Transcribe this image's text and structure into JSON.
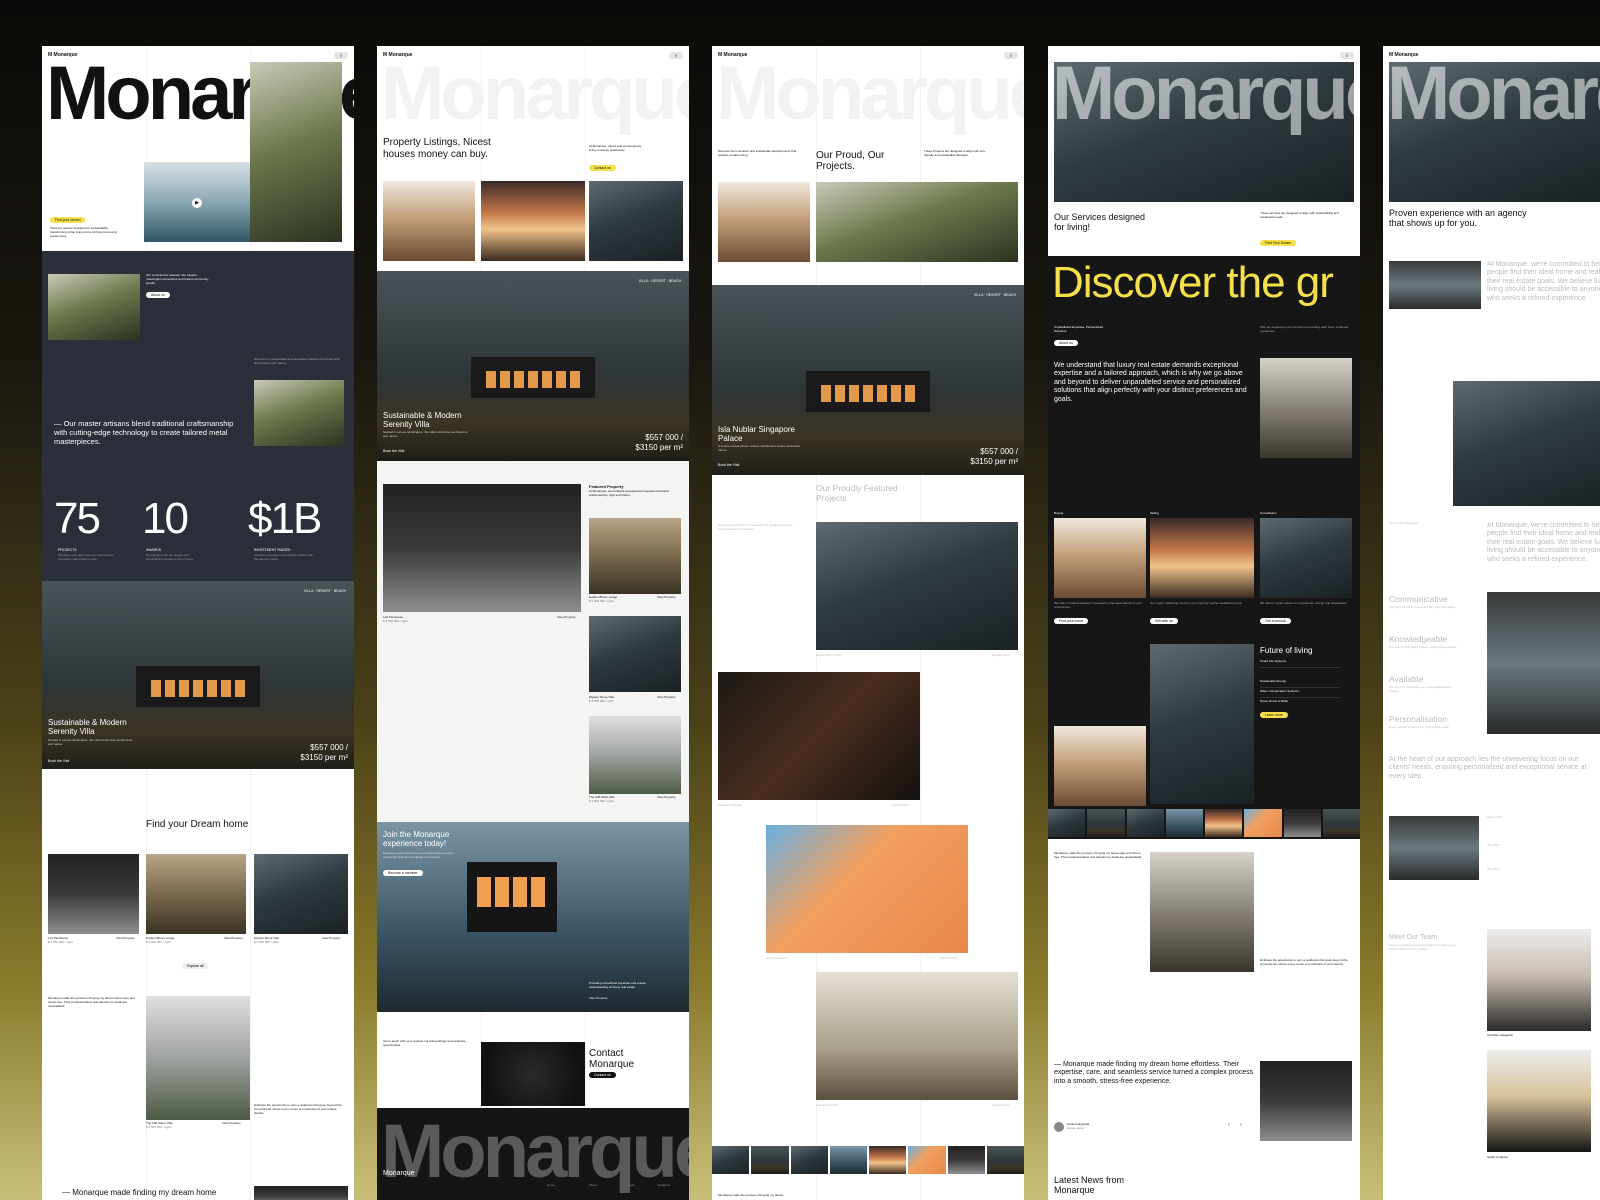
{
  "brand": "Monarque",
  "logo": "M Monarque",
  "menu": "≡",
  "p1": {
    "cta": "Find your dream",
    "intro": "Visionary spaces designed for sustainability, transforming urban living and enriching community experiences.",
    "about": "Our commitment extends: Our experts meaningful connections and fosters community growth.",
    "about_btn": "About us",
    "side_text": "We focus on sustainable and innovative solutions for homes that blend luxury with nature.",
    "quote": "— Our master artisans blend traditional craftsmanship with cutting-edge technology to create tailored metal masterpieces.",
    "stats": [
      {
        "value": "75",
        "label": "PROJECTS",
        "desc": "Monarque has delivered over seventy-five properties nationwide to date."
      },
      {
        "value": "10",
        "label": "AWARDS",
        "desc": "Recognized with ten design and sustainability awards in the industry."
      },
      {
        "value": "$1B",
        "label": "INVESTMENT RAISED",
        "desc": "Investors entrusted over a billion dollars with Monarque's vision."
      }
    ],
    "tags": "VILLA · RESORT · BEACH",
    "villa_title": "Sustainable & Modern Serenity Villa",
    "villa_desc": "Nestled in serene landscapes, this villa harmonizes architecture and nature.",
    "villa_price": "$557 000 / $3150 per m²",
    "book": "Book the Visit",
    "dream": "Find your Dream home",
    "cards": [
      {
        "name": "Loft Penthouse",
        "price": "$ 4 650 000 / night",
        "link": "View Property"
      },
      {
        "name": "Golden Bloom Lodge",
        "price": "$ 2 000 000 / night",
        "link": "View Property"
      },
      {
        "name": "Elysian Shore Villa",
        "price": "$ 3 500 000 / night",
        "link": "View Property"
      }
    ],
    "explore": "Explore all",
    "simplify": "Monarque made the process of buying my dream home easy and stress-free. Their professionalism and attention to detail are unparalleled.",
    "cliff_name": "The Cliff Stand Villa",
    "cliff_price": "$ 4 500 000 / night",
    "cliff_link": "View Property",
    "cliff_note": "Embrace the opportunity to own a residence that goes beyond the conventional, where every corner is a reflection of your unique identity.",
    "bottom_quote": "— Monarque made finding my dream home"
  },
  "p2": {
    "headline": "Property Listings, Nicest houses money can buy.",
    "sub": "At Monarque, nature and contemporary living converge seamlessly.",
    "sub_btn": "Contact us",
    "tags": "VILLA · RESORT · BEACH",
    "villa_title": "Sustainable & Modern Serenity Villa",
    "villa_desc": "Nestled in serene landscapes, this villa harmonizes architecture and nature.",
    "villa_price": "$557 000 / $3150 per m²",
    "book": "Book the Visit",
    "featured": "Featured Property",
    "featured_desc": "At Monarque, we handpick exceptional properties that blend craftsmanship, light and nature.",
    "loft": "Loft Penthouse",
    "loft_price": "$ 4 650 000 / night",
    "loft_link": "View Property",
    "side": [
      {
        "name": "Golden Bloom Lodge",
        "price": "$ 2 000 000 / night",
        "link": "View Property"
      },
      {
        "name": "Elysian Shore Villa",
        "price": "$ 3 500 000 / night",
        "link": "View Property"
      },
      {
        "name": "The Cliff Shelf Villa",
        "price": "$ 4 500 000 / night",
        "link": "View Property"
      }
    ],
    "join": "Join the Monarque experience today!",
    "join_desc": "Monarque opens the doors to exclusive homes and a community built around design and comfort.",
    "join_btn": "Become a member",
    "join_side": "Providing unmatched expertise and a deep understanding of luxury real estate.",
    "join_link": "View Property",
    "contact_desc": "Get in touch with us to explore our latest listings and exclusive opportunities.",
    "contact": "Contact Monarque",
    "contact_btn": "Contact us",
    "footer_logo": "Monarque",
    "footer_cols": [
      "Home",
      "About",
      "Legal",
      "Instagram"
    ]
  },
  "p3": {
    "intro": "Discover the innovative and sustainable developments that redefine modern living.",
    "headline": "Our Proud, Our Projects.",
    "side": "These Projects are designed to align with eco-friendly and sustainable lifestyles.",
    "tags": "VILLA · RESORT · BEACH",
    "villa_title": "Isla Nublar Singapore Palace",
    "villa_desc": "A serene retreat where modern architecture meets untouched nature.",
    "villa_price": "$557 000 / $3150 per m²",
    "book": "Book the Visit",
    "featured": "Our Proudly Featured Projects",
    "featured_desc": "Each project reflects our dedication to design excellence and sustainable innovation.",
    "cap1": "Elysian Shore Villa",
    "cap1b": "Explore More",
    "cap2": "Obsidian Stairway",
    "cap2b": "Explore More",
    "cap3": "Coral Apartment",
    "cap3b": "Explore More",
    "cap4": "Meadow Pavilion",
    "cap4b": "Explore More",
    "bottom": "Monarque made the process of buying my dream"
  },
  "p4": {
    "services": "Our Services designed for living!",
    "services_side": "These services are designed to align with sustainability and residential needs.",
    "services_btn": "Find Your Dream",
    "marquee": "Discover the gr",
    "expertise": "Unparalleled Expertise, Personalized Solutions",
    "expertise_btn": "About us",
    "expertise_side": "With an unwavering commitment to providing each client a tailored experience.",
    "paragraph": "We understand that luxury real estate demands exceptional expertise and a tailored approach, which is why we go above and beyond to deliver unparalleled service and personalized solutions that align perfectly with your distinct preferences and goals.",
    "svc": [
      {
        "name": "Buying",
        "desc": "We offer a curated selection of exquisite properties tailored to your preferences.",
        "btn": "Find your home"
      },
      {
        "name": "Selling",
        "desc": "Our expert marketing ensures your property reaches qualified buyers.",
        "btn": "Sell with us"
      },
      {
        "name": "Consultation",
        "desc": "We deliver expert advice on investments, design and acquisitions.",
        "btn": "Get a consult"
      }
    ],
    "future": "Future of living",
    "future_items": [
      "Smart Life Systems",
      "Sustainable Energy",
      "Water Conservation Systems",
      "Green Roofs & Walls"
    ],
    "future_btn": "Learn more",
    "buy_text": "Monarque made the process of buying my home easy and stress-free. Their professionalism and attention to detail are unparalleled.",
    "embrace": "Embrace the opportunity to own a residence that goes beyond the conventional, where every corner is a reflection of your identity.",
    "quote": "— Monarque made finding my dream home effortless. Their expertise, care, and seamless service turned a complex process into a smooth, stress-free experience.",
    "author": "Daniel Haygarda",
    "author_role": "Home owner",
    "news": "Latest News from Monarque"
  },
  "p5": {
    "headline": "Proven experience with an agency that shows up for you.",
    "text1": "At Monarque, we're committed to helping people find their ideal home and realize their real estate goals. We believe luxury living should be accessible to anyone who seeks a refined experience.",
    "years": "Since 2010 Monarque",
    "text2": "At Monarque, we're committed to helping people find their ideal home and realize their real estate goals. We believe luxury living should be accessible to anyone who seeks a refined experience.",
    "values": [
      {
        "name": "Communicative",
        "desc": "We keep clients informed at every step with clarity."
      },
      {
        "name": "Knowledgeable",
        "desc": "Our team brings deep market insight and expertise."
      },
      {
        "name": "Available",
        "desc": "We are here whenever you need guidance and support."
      },
      {
        "name": "Personalisation",
        "desc": "Every service is tailored to your unique vision."
      }
    ],
    "heart": "At the heart of our approach lies the unwavering focus on our clients' needs, ensuring personalized and exceptional service at every step.",
    "mini1": "Since 2010",
    "mini2": "Our 2020",
    "mini3": "Our 2024",
    "team": "Meet Our Team",
    "team_desc": "Meet our dedicated professionals who make every client's dream home a reality.",
    "m1": "Christian Haygarda",
    "m2": "Sarah Lindqvist"
  }
}
